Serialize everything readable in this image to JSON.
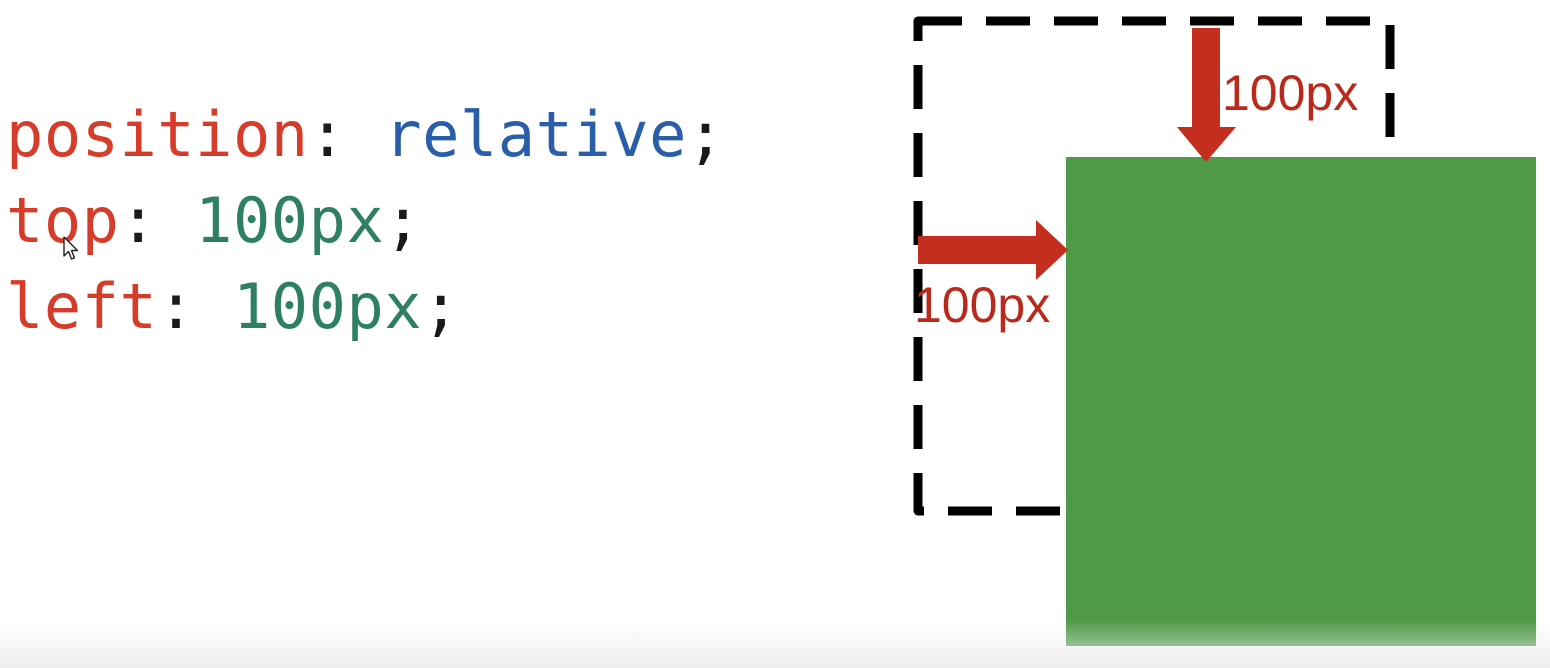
{
  "code": {
    "line1": {
      "property": "position",
      "colon": ": ",
      "value": "relative",
      "semicolon": ";"
    },
    "line2": {
      "property": "top",
      "colon": ": ",
      "value": "100px",
      "semicolon": ";"
    },
    "line3": {
      "property": "left",
      "colon": ": ",
      "value": "100px",
      "semicolon": ";"
    }
  },
  "diagram": {
    "top_offset_label": "100px",
    "left_offset_label": "100px"
  },
  "icons": {
    "cursor": "mouse-pointer-icon"
  },
  "colors": {
    "property": "#d63c2a",
    "keyword": "#2a5ea8",
    "number": "#2f8062",
    "box_fill": "#4f9a47",
    "arrow": "#c42e1f",
    "dashed_outline": "#000000"
  }
}
